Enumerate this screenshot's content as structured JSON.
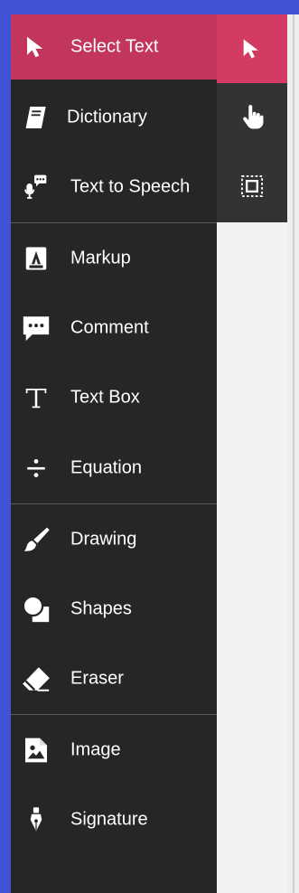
{
  "menu": {
    "items": [
      {
        "label": "Select Text",
        "icon": "cursor-arrow-icon"
      },
      {
        "label": "Dictionary",
        "icon": "book-icon"
      },
      {
        "label": "Text to Speech",
        "icon": "microphone-speech-icon"
      },
      {
        "label": "Markup",
        "icon": "highlighter-icon"
      },
      {
        "label": "Comment",
        "icon": "comment-icon"
      },
      {
        "label": "Text Box",
        "icon": "text-t-icon"
      },
      {
        "label": "Equation",
        "icon": "divide-icon"
      },
      {
        "label": "Drawing",
        "icon": "brush-icon"
      },
      {
        "label": "Shapes",
        "icon": "shapes-icon"
      },
      {
        "label": "Eraser",
        "icon": "eraser-icon"
      },
      {
        "label": "Image",
        "icon": "image-icon"
      },
      {
        "label": "Signature",
        "icon": "pen-nib-icon"
      }
    ],
    "active_index": 0
  },
  "quick_tools": [
    {
      "icon": "cursor-arrow-icon",
      "active": true
    },
    {
      "icon": "hand-pointer-icon",
      "active": false
    },
    {
      "icon": "marquee-select-icon",
      "active": false
    }
  ],
  "colors": {
    "frame_border": "#4153d4",
    "menu_bg": "#262626",
    "active_item": "#c2365e",
    "quick_bg": "#333333",
    "quick_active": "#d23c63"
  }
}
